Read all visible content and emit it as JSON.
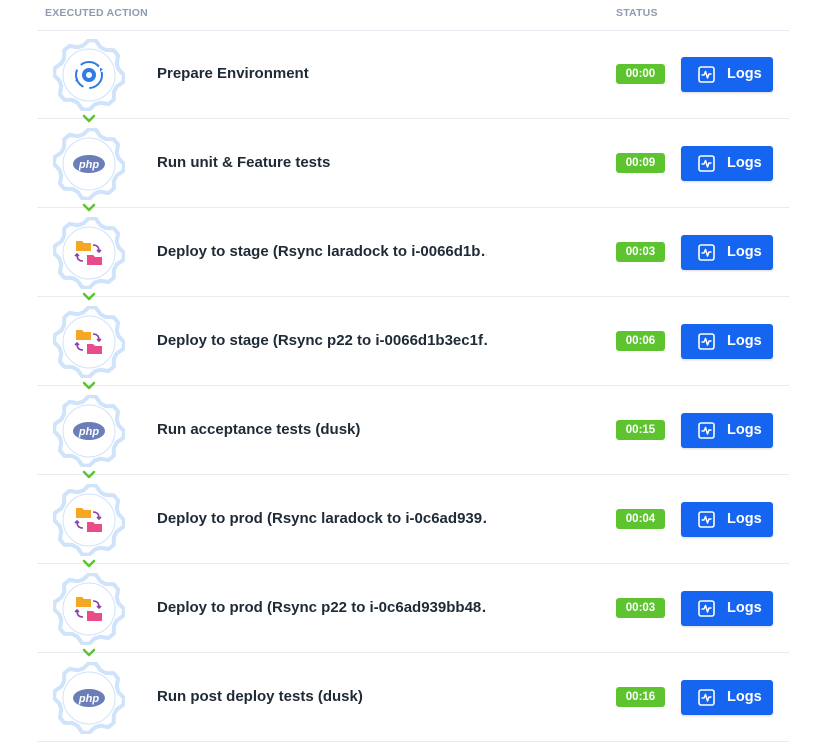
{
  "table": {
    "header": {
      "action": "EXECUTED ACTION",
      "status": "STATUS"
    },
    "rows": [
      {
        "icon": "gear-sync-icon",
        "title": "Prepare Environment",
        "duration": "00:00",
        "logs_label": "Logs"
      },
      {
        "icon": "php-icon",
        "title": "Run unit & Feature tests",
        "duration": "00:09",
        "logs_label": "Logs"
      },
      {
        "icon": "folder-transfer-icon",
        "title": "Deploy to stage (Rsync laradock to i-0066d1b…",
        "duration": "00:03",
        "logs_label": "Logs"
      },
      {
        "icon": "folder-transfer-icon",
        "title": "Deploy to stage (Rsync p22 to i-0066d1b3ec1f…",
        "duration": "00:06",
        "logs_label": "Logs"
      },
      {
        "icon": "php-icon",
        "title": "Run acceptance tests (dusk)",
        "duration": "00:15",
        "logs_label": "Logs"
      },
      {
        "icon": "folder-transfer-icon",
        "title": "Deploy to prod (Rsync laradock to i-0c6ad939…",
        "duration": "00:04",
        "logs_label": "Logs"
      },
      {
        "icon": "folder-transfer-icon",
        "title": "Deploy to prod (Rsync p22 to i-0c6ad939bb48…",
        "duration": "00:03",
        "logs_label": "Logs"
      },
      {
        "icon": "php-icon",
        "title": "Run post deploy tests (dusk)",
        "duration": "00:16",
        "logs_label": "Logs"
      }
    ],
    "php_text": "php"
  },
  "colors": {
    "status_success": "#5dc430",
    "logs_button": "#1565f0",
    "gear_outline": "#cfe3fb",
    "connector": "#5dc430"
  }
}
